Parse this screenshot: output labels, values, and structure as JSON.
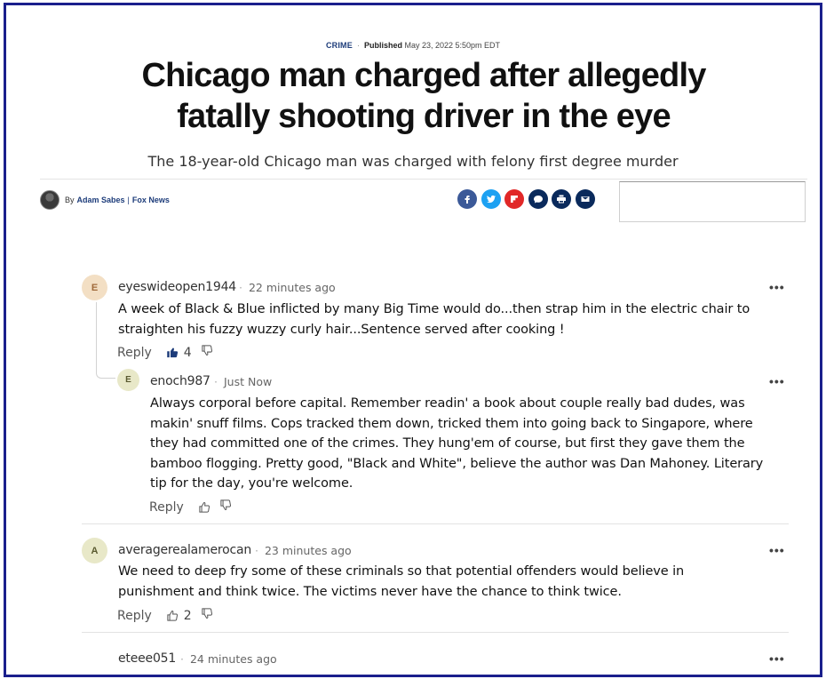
{
  "article": {
    "category": "CRIME",
    "published_label": "Published",
    "published_date": "May 23, 2022 5:50pm EDT",
    "headline_line1": "Chicago man charged after allegedly",
    "headline_line2": "fatally shooting driver in the eye",
    "subheadline": "The 18-year-old Chicago man was charged with felony first degree murder",
    "byline_prefix": "By",
    "author": "Adam Sabes",
    "byline_separator": "|",
    "outlet": "Fox News"
  },
  "share": [
    {
      "name": "facebook",
      "glyph": "f",
      "color": "#3b5998"
    },
    {
      "name": "twitter",
      "glyph": "t",
      "color": "#1da1f2"
    },
    {
      "name": "flipboard",
      "glyph": "F",
      "color": "#e12828"
    },
    {
      "name": "comments",
      "glyph": "c",
      "color": "#0a2a5c"
    },
    {
      "name": "print",
      "glyph": "p",
      "color": "#0a2a5c"
    },
    {
      "name": "email",
      "glyph": "e",
      "color": "#0a2a5c"
    }
  ],
  "comments": [
    {
      "avatar_letter": "E",
      "avatar_color": "#f3dfc4",
      "username": "eyeswideopen1944",
      "time": "22 minutes ago",
      "body": "A week of Black & Blue inflicted by many Big Time would do...then strap him in the electric chair to straighten his fuzzy wuzzy curly hair...Sentence served after cooking !",
      "reply_label": "Reply",
      "likes": "4",
      "liked": true
    },
    {
      "avatar_letter": "E",
      "avatar_color": "#e8e8c8",
      "username": "enoch987",
      "time": "Just Now",
      "body": "Always corporal before capital.  Remember readin' a book about couple really bad dudes, was makin' snuff films.  Cops tracked them down, tricked them into going back to Singapore, where they had committed one of the crimes.  They hung'em of course, but first they gave them the bamboo flogging.  Pretty good, \"Black and White\", believe the author was Dan Mahoney.  Literary tip for the day, you're welcome.",
      "reply_label": "Reply",
      "likes": "",
      "liked": false
    },
    {
      "avatar_letter": "A",
      "avatar_color": "#e8e8c8",
      "username": "averagerealamerocan",
      "time": "23 minutes ago",
      "body": "We need to deep fry some of these criminals so that potential offenders would believe in punishment and think twice.   The victims never have the chance to think twice.",
      "reply_label": "Reply",
      "likes": "2",
      "liked": false
    },
    {
      "username": "eteee051",
      "time": "24 minutes ago"
    }
  ],
  "more_label": "•••"
}
